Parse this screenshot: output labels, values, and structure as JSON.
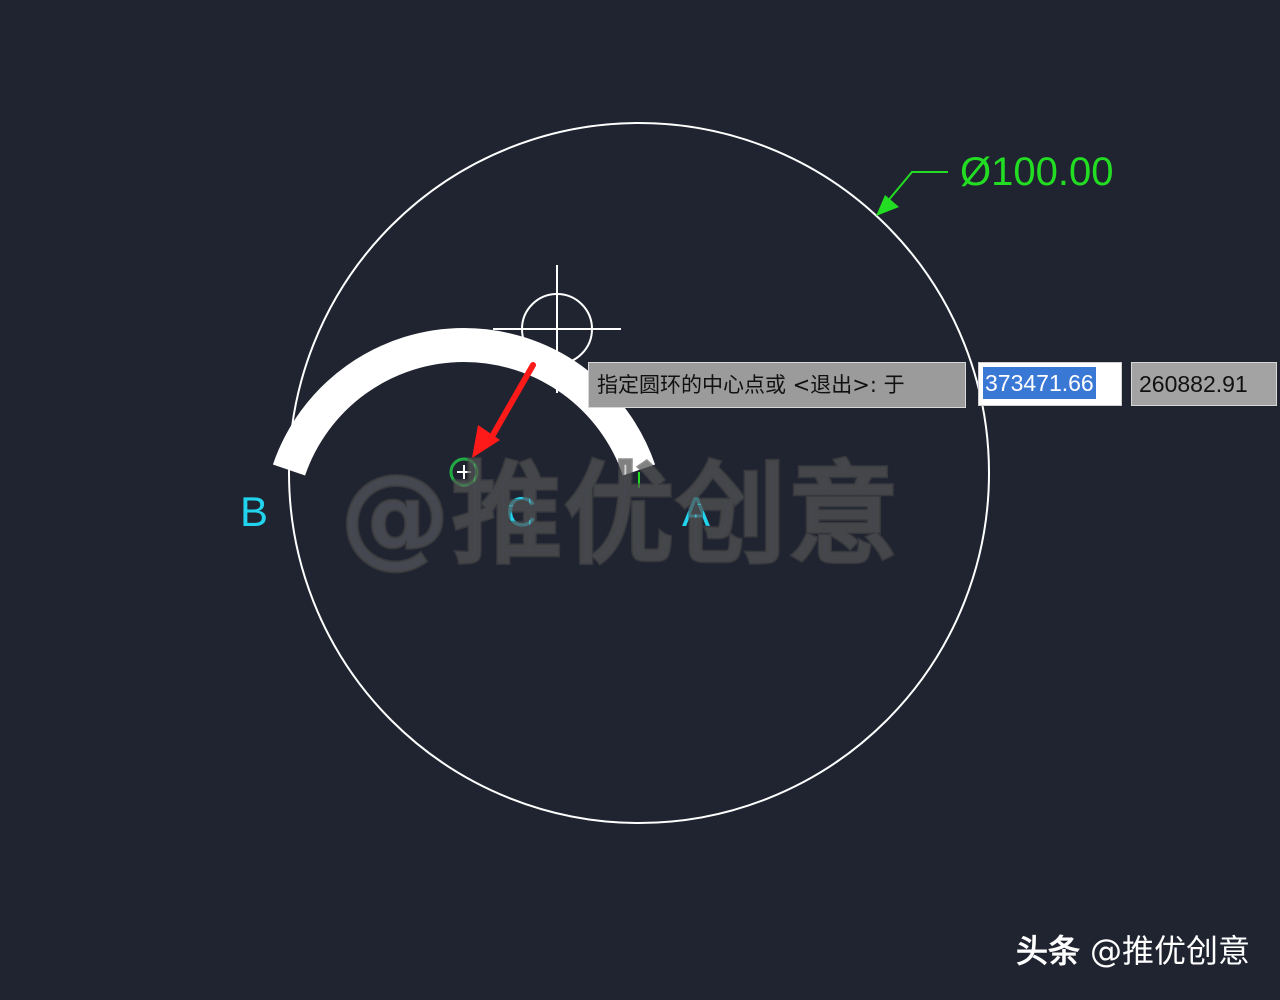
{
  "canvas": {
    "background": "#1f2430"
  },
  "dimension": {
    "text": "Ø100.00",
    "color": "#22dd22"
  },
  "points": {
    "a": "A",
    "b": "B",
    "c": "C",
    "color": "#22d3ee"
  },
  "command_prompt": {
    "text": "指定圆环的中心点或 <退出>: 于",
    "x_value": "373471.66",
    "y_value": "260882.91"
  },
  "watermark": {
    "text": "@推优创意"
  },
  "attribution": {
    "brand": "头条",
    "handle": "@推优创意"
  },
  "colors": {
    "arrow": "#ff1a1a",
    "circle": "#ffffff",
    "donut": "#ffffff",
    "snap_marker": "#22aa44"
  },
  "icons": [
    "crosshair-cursor-icon",
    "center-snap-marker-icon",
    "leader-arrow-icon"
  ]
}
